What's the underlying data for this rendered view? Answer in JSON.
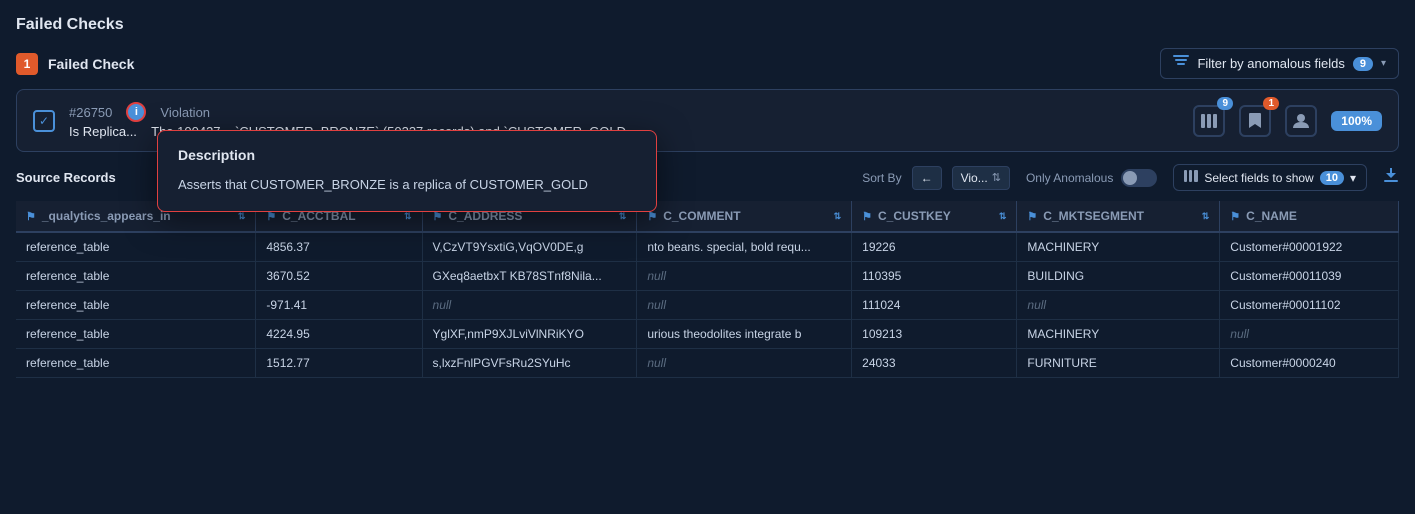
{
  "page": {
    "title": "Failed Checks"
  },
  "topBar": {
    "badge_number": "1",
    "failed_check_label": "Failed Check",
    "filter_btn_label": "Filter by anomalous fields",
    "filter_count": "9",
    "chevron": "▾"
  },
  "checkRow": {
    "check_id": "#26750",
    "violation_label": "Violation",
    "description_text": "The 100437... `CUSTOMER_BRONZE` (50237 records) and `CUSTOMER_GOLD...",
    "is_replica_label": "Is Replica...",
    "tooltip": {
      "title": "Description",
      "body": "Asserts that CUSTOMER_BRONZE is a replica of CUSTOMER_GOLD"
    },
    "badge1": "9",
    "badge2": "1",
    "percent": "100%"
  },
  "sourceRecords": {
    "title": "Source Records",
    "sort_label": "Sort By",
    "only_anomalous_label": "Only Anomalous",
    "select_fields_label": "Select fields to show",
    "select_count": "10"
  },
  "table": {
    "columns": [
      "_qualytics_appears_in",
      "C_ACCTBAL",
      "C_ADDRESS",
      "C_COMMENT",
      "C_CUSTKEY",
      "C_MKTSEGMENT",
      "C_NAME"
    ],
    "rows": [
      [
        "reference_table",
        "4856.37",
        "V,CzVT9YsxtiG,VqOV0DE,g",
        "nto beans. special, bold requ...",
        "19226",
        "MACHINERY",
        "Customer#00001922"
      ],
      [
        "reference_table",
        "3670.52",
        "GXeq8aetbxT KB78STnf8Nila...",
        "null",
        "110395",
        "BUILDING",
        "Customer#00011039"
      ],
      [
        "reference_table",
        "-971.41",
        "null",
        "null",
        "111024",
        "null",
        "Customer#00011102"
      ],
      [
        "reference_table",
        "4224.95",
        "YglXF,nmP9XJLviVlNRiKYO",
        "urious theodolites integrate b",
        "109213",
        "MACHINERY",
        "null"
      ],
      [
        "reference_table",
        "1512.77",
        "s,lxzFnlPGVFsRu2SYuHc",
        "null",
        "24033",
        "FURNITURE",
        "Customer#0000240"
      ]
    ]
  }
}
